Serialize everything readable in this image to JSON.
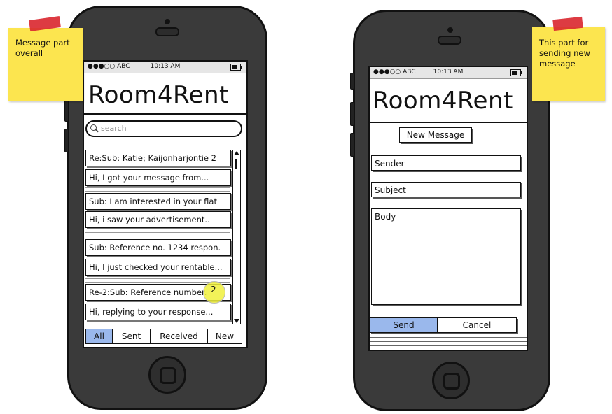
{
  "left_phone": {
    "status": {
      "carrier": "●●●○○ ABC",
      "time": "10:13 AM"
    },
    "app_title": "Room4Rent",
    "search_placeholder": "search",
    "messages": [
      {
        "subject": "Re:Sub: Katie; Kaijonharjontie 2",
        "preview": "Hi, I got your message from..."
      },
      {
        "subject": "Sub: I am interested in your flat",
        "preview": "Hi, i saw your advertisement.."
      },
      {
        "subject": "Sub: Reference no. 1234 respon.",
        "preview": "Hi, I just checked your rentable..."
      },
      {
        "subject": "Re-2:Sub: Reference number.",
        "preview": "Hi, replying to your response..."
      }
    ],
    "badge_count": "2",
    "tabs": [
      "All",
      "Sent",
      "Received",
      "New"
    ],
    "active_tab": "All"
  },
  "right_phone": {
    "status": {
      "carrier": "●●●○○ ABC",
      "time": "10:13 AM"
    },
    "app_title": "Room4Rent",
    "new_message_label": "New Message",
    "sender_label": "Sender",
    "subject_label": "Subject",
    "body_label": "Body",
    "send_label": "Send",
    "cancel_label": "Cancel"
  },
  "notes": {
    "left": "Message part overall",
    "right": "This part for sending new message"
  },
  "colors": {
    "sticky": "#fce54f",
    "tape": "#d9262d",
    "active_tab": "#9ab8ec",
    "phone_body": "#3a3a3a",
    "badge": "#f0f03c"
  }
}
